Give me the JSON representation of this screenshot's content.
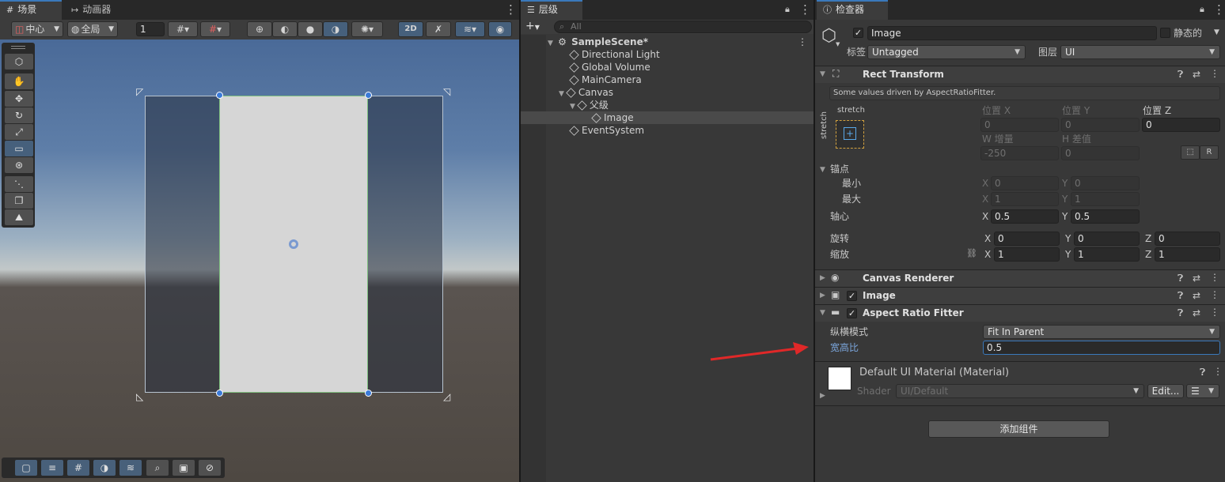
{
  "scene_panel": {
    "tabs": [
      {
        "icon": "grid-icon",
        "label": "场景"
      },
      {
        "icon": "animator-icon",
        "label": "动画器"
      }
    ],
    "toolbar": {
      "pivot_label": "中心",
      "global_label": "全局",
      "grid_value": "1",
      "mode_2d": "2D"
    }
  },
  "hierarchy": {
    "tab_label": "层级",
    "search_placeholder": "All",
    "items": [
      {
        "label": "SampleScene*",
        "depth": 0,
        "bold": true,
        "expanded": true
      },
      {
        "label": "Directional Light",
        "depth": 1
      },
      {
        "label": "Global Volume",
        "depth": 1
      },
      {
        "label": "MainCamera",
        "depth": 1
      },
      {
        "label": "Canvas",
        "depth": 1,
        "expanded": true
      },
      {
        "label": "父级",
        "depth": 2,
        "expanded": true
      },
      {
        "label": "Image",
        "depth": 3,
        "selected": true
      },
      {
        "label": "EventSystem",
        "depth": 1
      }
    ]
  },
  "inspector": {
    "tab_label": "检查器",
    "object_name": "Image",
    "static_label": "静态的",
    "tag_label": "标签",
    "tag_value": "Untagged",
    "layer_label": "图层",
    "layer_value": "UI",
    "rect_transform": {
      "title": "Rect Transform",
      "driven_note": "Some values driven by AspectRatioFitter.",
      "stretch_h": "stretch",
      "stretch_v": "stretch",
      "pos_x_label": "位置 X",
      "pos_y_label": "位置 Y",
      "pos_z_label": "位置 Z",
      "pos_x": "0",
      "pos_y": "0",
      "pos_z": "0",
      "w_label": "W 增量",
      "h_label": "H 差值",
      "w_value": "-250",
      "h_value": "0",
      "r_button": "R",
      "anchors_label": "锚点",
      "min_label": "最小",
      "max_label": "最大",
      "min_x": "0",
      "min_y": "0",
      "max_x": "1",
      "max_y": "1",
      "pivot_label": "轴心",
      "pivot_x": "0.5",
      "pivot_y": "0.5",
      "rotation_label": "旋转",
      "rot_x": "0",
      "rot_y": "0",
      "rot_z": "0",
      "scale_label": "缩放",
      "scale_x": "1",
      "scale_y": "1",
      "scale_z": "1",
      "x": "X",
      "y": "Y",
      "z": "Z"
    },
    "canvas_renderer": "Canvas Renderer",
    "image_component": "Image",
    "aspect_ratio_fitter": {
      "title": "Aspect Ratio Fitter",
      "mode_label": "纵横模式",
      "mode_value": "Fit In Parent",
      "ratio_label": "宽高比",
      "ratio_value": "0.5"
    },
    "material": {
      "name": "Default UI Material (Material)",
      "shader_label": "Shader",
      "shader_value": "UI/Default",
      "edit_label": "Edit..."
    },
    "add_component": "添加组件"
  },
  "colors": {
    "accent": "#3a79bb",
    "selection": "#46607c",
    "arrow": "#e02828",
    "label_highlight": "#7ba6dc"
  }
}
